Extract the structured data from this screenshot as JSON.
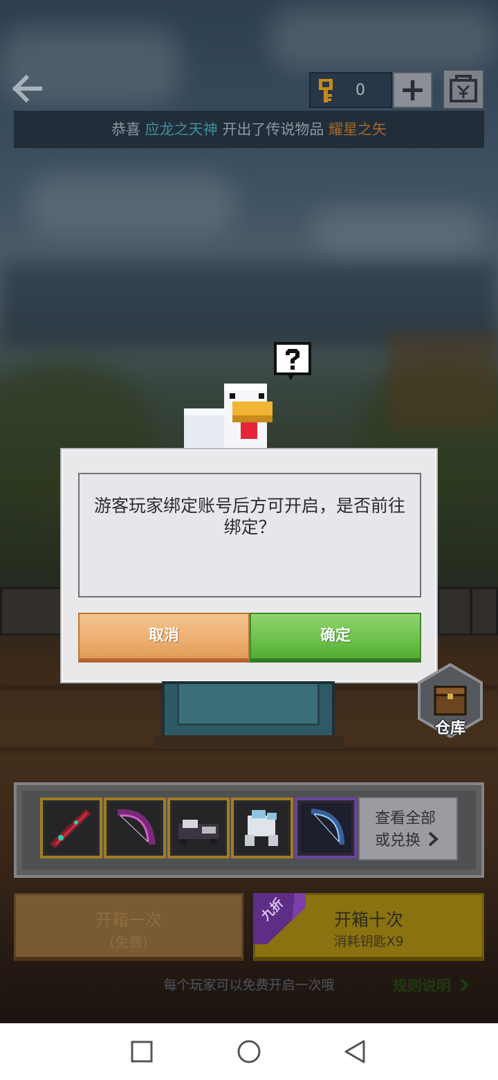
{
  "top_bar": {
    "key_count": "0",
    "banner": {
      "prefix": "恭喜",
      "player": "应龙之天神",
      "middle": "开出了传说物品",
      "item": "耀星之矢"
    }
  },
  "dialog": {
    "message": "游客玩家绑定账号后方可开启，是否前往绑定？",
    "cancel_label": "取消",
    "confirm_label": "确定"
  },
  "warehouse": {
    "label": "仓库"
  },
  "rewards": {
    "items": [
      {
        "icon": "red-staff-icon",
        "rarity": "gold"
      },
      {
        "icon": "pink-bow-icon",
        "rarity": "gold"
      },
      {
        "icon": "dark-mount-icon",
        "rarity": "gold"
      },
      {
        "icon": "white-mech-icon",
        "rarity": "gold"
      },
      {
        "icon": "blue-bow-icon",
        "rarity": "purple"
      }
    ],
    "view_all_line1": "查看全部",
    "view_all_line2": "或兑换"
  },
  "open_buttons": {
    "once_title": "开箱一次",
    "once_sub": "(免费)",
    "ten_title": "开箱十次",
    "ten_sub": "消耗钥匙X9",
    "discount_badge": "九折"
  },
  "footer": {
    "free_note": "每个玩家可以免费开启一次哦",
    "rules_link": "规则说明"
  },
  "colors": {
    "cancel_button": "#eeb074",
    "confirm_button": "#6fc24e",
    "player_highlight": "#3f8f9a",
    "item_highlight": "#a56a26"
  }
}
